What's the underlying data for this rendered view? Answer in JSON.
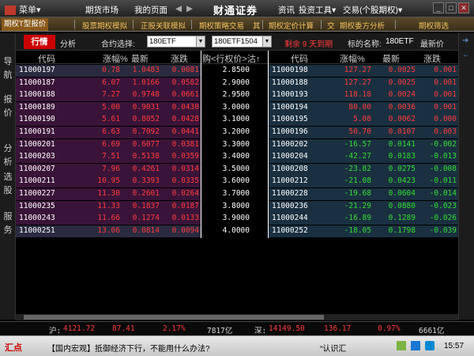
{
  "titlebar": {
    "menu_label": "菜单▾",
    "nav": [
      "期货市场",
      "我的页面"
    ],
    "brand": "财通证券",
    "right_links": [
      "资讯",
      "投资工具▾",
      "交易(个股期权)▾"
    ]
  },
  "toolbar2": {
    "items": [
      "期权T型报价",
      "股票期权模拟",
      "正股关联模拟",
      "期权策略交易",
      "其",
      "期权定价计算",
      "交",
      "期权委方分析",
      "期权筛选"
    ]
  },
  "filterbar": {
    "tab_active": "行情",
    "tab_other": "分析",
    "contract_label": "合约选择:",
    "contract_value": "180ETF",
    "month_value": "180ETF1504",
    "remaining": "剩余 9 天到期",
    "underlying_label": "标的名称:",
    "underlying_value": "180ETF",
    "latest_label": "最新价"
  },
  "leftnav": [
    "导",
    "航",
    "报",
    "价",
    "分",
    "析",
    "选",
    "股",
    "服",
    "务"
  ],
  "grid": {
    "headers": {
      "code": "代码",
      "change": "涨幅%",
      "latest": "最新",
      "diff": "涨跌",
      "strike": "购<行权价>沽↑",
      "code2": "代码",
      "change2": "涨幅%",
      "latest2": "最新",
      "diff2": "涨跌"
    },
    "rows": [
      {
        "c_code": "11000197",
        "c_chg": "0.78",
        "c_last": "1.0483",
        "c_diff": "0.0081",
        "strike": "2.8500",
        "p_code": "11000198",
        "p_chg": "127.27",
        "p_last": "0.0025",
        "p_diff": "0.001"
      },
      {
        "c_code": "11000187",
        "c_chg": "6.07",
        "c_last": "1.0166",
        "c_diff": "0.0582",
        "strike": "2.9000",
        "p_code": "11000188",
        "p_chg": "127.27",
        "p_last": "0.0025",
        "p_diff": "0.001"
      },
      {
        "c_code": "11000188",
        "c_chg": "7.27",
        "c_last": "0.9748",
        "c_diff": "0.0661",
        "strike": "2.9500",
        "p_code": "11000193",
        "p_chg": "118.18",
        "p_last": "0.0024",
        "p_diff": "0.001"
      },
      {
        "c_code": "11000189",
        "c_chg": "5.00",
        "c_last": "0.9031",
        "c_diff": "0.0430",
        "strike": "3.0000",
        "p_code": "11000194",
        "p_chg": "80.00",
        "p_last": "0.0036",
        "p_diff": "0.001"
      },
      {
        "c_code": "11000190",
        "c_chg": "5.61",
        "c_last": "0.8052",
        "c_diff": "0.0428",
        "strike": "3.1000",
        "p_code": "11000195",
        "p_chg": "5.08",
        "p_last": "0.0062",
        "p_diff": "0.000"
      },
      {
        "c_code": "11000191",
        "c_chg": "6.63",
        "c_last": "0.7092",
        "c_diff": "0.0441",
        "strike": "3.2000",
        "p_code": "11000196",
        "p_chg": "50.70",
        "p_last": "0.0107",
        "p_diff": "0.003"
      },
      {
        "c_code": "11000201",
        "c_chg": "6.69",
        "c_last": "0.6077",
        "c_diff": "0.0381",
        "strike": "3.3000",
        "p_code": "11000202",
        "p_chg": "-16.57",
        "p_last": "0.0141",
        "p_diff": "-0.002"
      },
      {
        "c_code": "11000203",
        "c_chg": "7.51",
        "c_last": "0.5138",
        "c_diff": "0.0359",
        "strike": "3.4000",
        "p_code": "11000204",
        "p_chg": "-42.27",
        "p_last": "0.0183",
        "p_diff": "-0.013"
      },
      {
        "c_code": "11000207",
        "c_chg": "7.96",
        "c_last": "0.4261",
        "c_diff": "0.0314",
        "strike": "3.5000",
        "p_code": "11000208",
        "p_chg": "-23.82",
        "p_last": "0.0275",
        "p_diff": "-0.008"
      },
      {
        "c_code": "11000211",
        "c_chg": "10.95",
        "c_last": "0.3393",
        "c_diff": "0.0335",
        "strike": "3.6000",
        "p_code": "11000212",
        "p_chg": "-21.08",
        "p_last": "0.0423",
        "p_diff": "-0.011"
      },
      {
        "c_code": "11000227",
        "c_chg": "11.30",
        "c_last": "0.2601",
        "c_diff": "0.0264",
        "strike": "3.7000",
        "p_code": "11000228",
        "p_chg": "-19.68",
        "p_last": "0.0604",
        "p_diff": "-0.014"
      },
      {
        "c_code": "11000235",
        "c_chg": "11.33",
        "c_last": "0.1837",
        "c_diff": "0.0187",
        "strike": "3.8000",
        "p_code": "11000236",
        "p_chg": "-21.29",
        "p_last": "0.0880",
        "p_diff": "-0.023"
      },
      {
        "c_code": "11000243",
        "c_chg": "11.66",
        "c_last": "0.1274",
        "c_diff": "0.0133",
        "strike": "3.9000",
        "p_code": "11000244",
        "p_chg": "-16.89",
        "p_last": "0.1289",
        "p_diff": "-0.026"
      },
      {
        "c_code": "11000251",
        "c_chg": "13.06",
        "c_last": "0.0814",
        "c_diff": "0.0094",
        "strike": "4.0000",
        "p_code": "11000252",
        "p_chg": "-18.05",
        "p_last": "0.1798",
        "p_diff": "-0.039"
      }
    ]
  },
  "statusbar": {
    "sh_label": "沪:",
    "sh_index": "4121.72",
    "sh_change": "87.41",
    "sh_pct": "2.17%",
    "sh_volume": "7817亿",
    "sz_label": "深:",
    "sz_index": "14149.50",
    "sz_change": "136.17",
    "sz_pct": "0.97%",
    "sz_volume": "6661亿"
  },
  "newsbar": {
    "logo": "汇点",
    "headline": "【国内宏观】抵御经济下行，不能用什么办法?",
    "headline2": "“认识汇",
    "time": "15:57"
  },
  "colors": {
    "up": "#ff3b3b",
    "down": "#33dd33",
    "call_row": "#3a1438",
    "call_row_alt": "#2a2a40",
    "put_row": "#1a3040",
    "active_tab": "#cc0000"
  }
}
